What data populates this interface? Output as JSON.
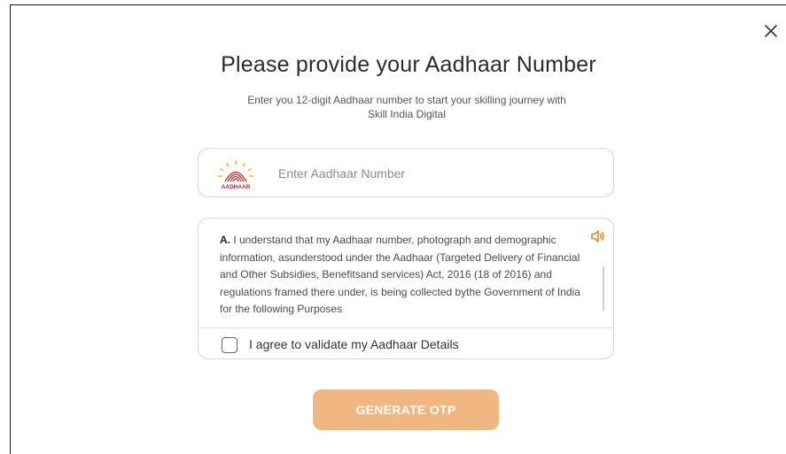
{
  "dialog": {
    "title": "Please provide your Aadhaar Number",
    "subtitle": "Enter you 12-digit Aadhaar number to start your skilling journey with Skill India Digital"
  },
  "aadhaar_input": {
    "placeholder": "Enter Aadhaar Number",
    "value": "",
    "logo_text": "AADHAAR",
    "icon": "aadhaar-logo-icon"
  },
  "consent": {
    "prefix": "A.",
    "text": "I understand that my Aadhaar number, photograph and demographic information, asunderstood under the Aadhaar (Targeted Delivery of Financial and Other Subsidies, Benefitsand services) Act, 2016 (18 of 2016) and regulations framed there under, is being collected bythe Government of India for the following Purposes",
    "speaker_icon": "speaker-icon"
  },
  "agree": {
    "label": "I agree to validate my Aadhaar Details",
    "checked": false
  },
  "buttons": {
    "generate_otp": "GENERATE OTP",
    "close_icon": "close-icon"
  },
  "colors": {
    "accent": "#f1b783",
    "speaker": "#e08a2e",
    "aadhaar_red": "#c8272d",
    "aadhaar_yellow": "#f6b21b"
  }
}
